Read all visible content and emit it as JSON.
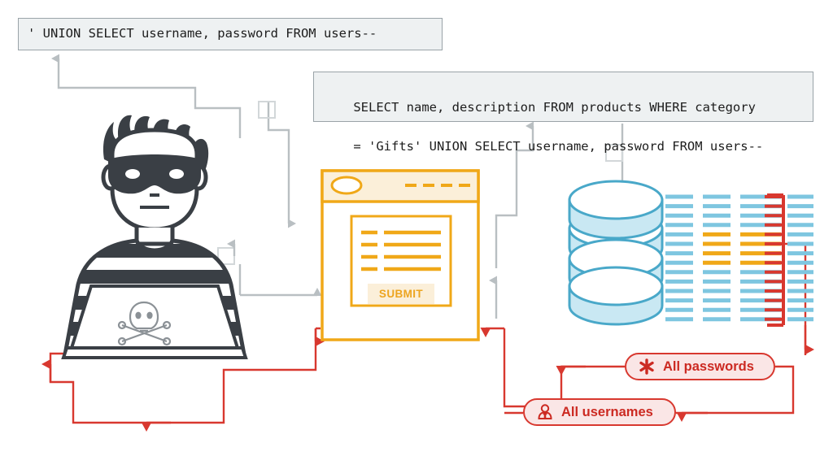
{
  "diagram": {
    "title": "SQL Injection UNION Attack Flow",
    "colors": {
      "gray_wire": "#b9bfc2",
      "red_flow": "#d8382f",
      "red_dark": "#cc2a22",
      "orange": "#f0a818",
      "orange_light": "#fbefd9",
      "blue": "#49a8c9",
      "blue_light": "#c9e8f3",
      "code_bg": "#eef1f2",
      "code_border": "#9aa3a8",
      "badge_bg": "#fae6e6",
      "hacker_dark": "#3a3f45"
    }
  },
  "code_boxes": {
    "payload": "' UNION SELECT username, password FROM users--",
    "query_line1": "SELECT name, description FROM products WHERE category",
    "query_line2": "= 'Gifts' UNION SELECT username, password FROM users--"
  },
  "browser": {
    "submit_label": "SUBMIT",
    "header_dashes": 5,
    "form_rows": 4
  },
  "database": {
    "disk_count": 4,
    "grid_columns": 4,
    "grid_rows": 14,
    "highlighted_rows": [
      4,
      5,
      6,
      7
    ],
    "highlighted_columns": [
      2,
      3
    ]
  },
  "badges": [
    {
      "id": "all-passwords",
      "label": "All passwords",
      "icon": "asterisk-icon"
    },
    {
      "id": "all-usernames",
      "label": "All usernames",
      "icon": "user-icon"
    }
  ],
  "actors": {
    "hacker": "hacker-illustration",
    "laptop_emblem": "skull-and-crossbones-icon"
  }
}
